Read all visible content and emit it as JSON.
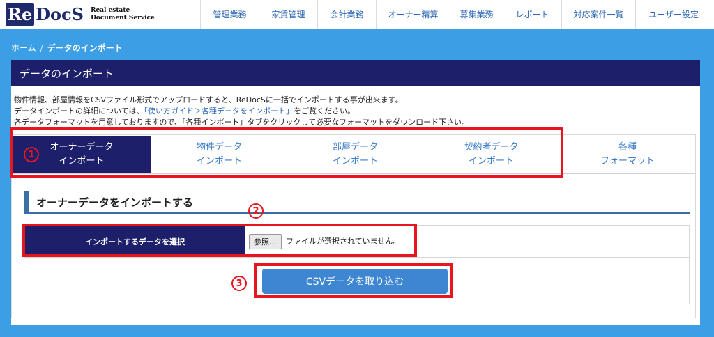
{
  "header": {
    "logo": {
      "mark_re": "Re",
      "mark_docs": "DocS",
      "sub_line1": "Real estate",
      "sub_line2": "Document Service"
    },
    "nav": [
      {
        "label": "管理業務"
      },
      {
        "label": "家賃管理"
      },
      {
        "label": "会計業務"
      },
      {
        "label": "オーナー精算"
      },
      {
        "label": "募集業務"
      },
      {
        "label": "レポート"
      },
      {
        "label": "対応案件一覧"
      },
      {
        "label": "ユーザー設定"
      }
    ]
  },
  "breadcrumb": {
    "home": "ホーム",
    "separator": "/",
    "current": "データのインポート"
  },
  "panel": {
    "title": "データのインポート",
    "desc_line1": "物件情報、部屋情報をCSVファイル形式でアップロードすると、ReDocSに一括でインポートする事が出来ます。",
    "desc_line2_pre": "データインポートの詳細については、",
    "desc_line2_link": "「使い方ガイド＞各種データをインポート」",
    "desc_line2_post": "をご覧ください。",
    "desc_line3": "各データフォーマットを用意しておりますので、「各種インポート」タブをクリックして必要なフォーマットをダウンロード下さい。"
  },
  "tabs": [
    {
      "line1": "オーナーデータ",
      "line2": "インポート",
      "active": true
    },
    {
      "line1": "物件データ",
      "line2": "インポート",
      "active": false
    },
    {
      "line1": "部屋データ",
      "line2": "インポート",
      "active": false
    },
    {
      "line1": "契約者データ",
      "line2": "インポート",
      "active": false
    },
    {
      "line1": "各種",
      "line2": "フォーマット",
      "active": false
    }
  ],
  "annotations": {
    "one": "1",
    "two": "2",
    "three": "3",
    "color": "#e8151f"
  },
  "section": {
    "title": "オーナーデータをインポートする"
  },
  "form": {
    "label": "インポートするデータを選択",
    "file_button": "参照...",
    "file_status": "ファイルが選択されていません。"
  },
  "submit": {
    "label": "CSVデータを取り込む"
  },
  "colors": {
    "navy": "#1e1f6b",
    "page_bg": "#3c9fe6",
    "link": "#2e68b6",
    "submit": "#3e86d2"
  }
}
